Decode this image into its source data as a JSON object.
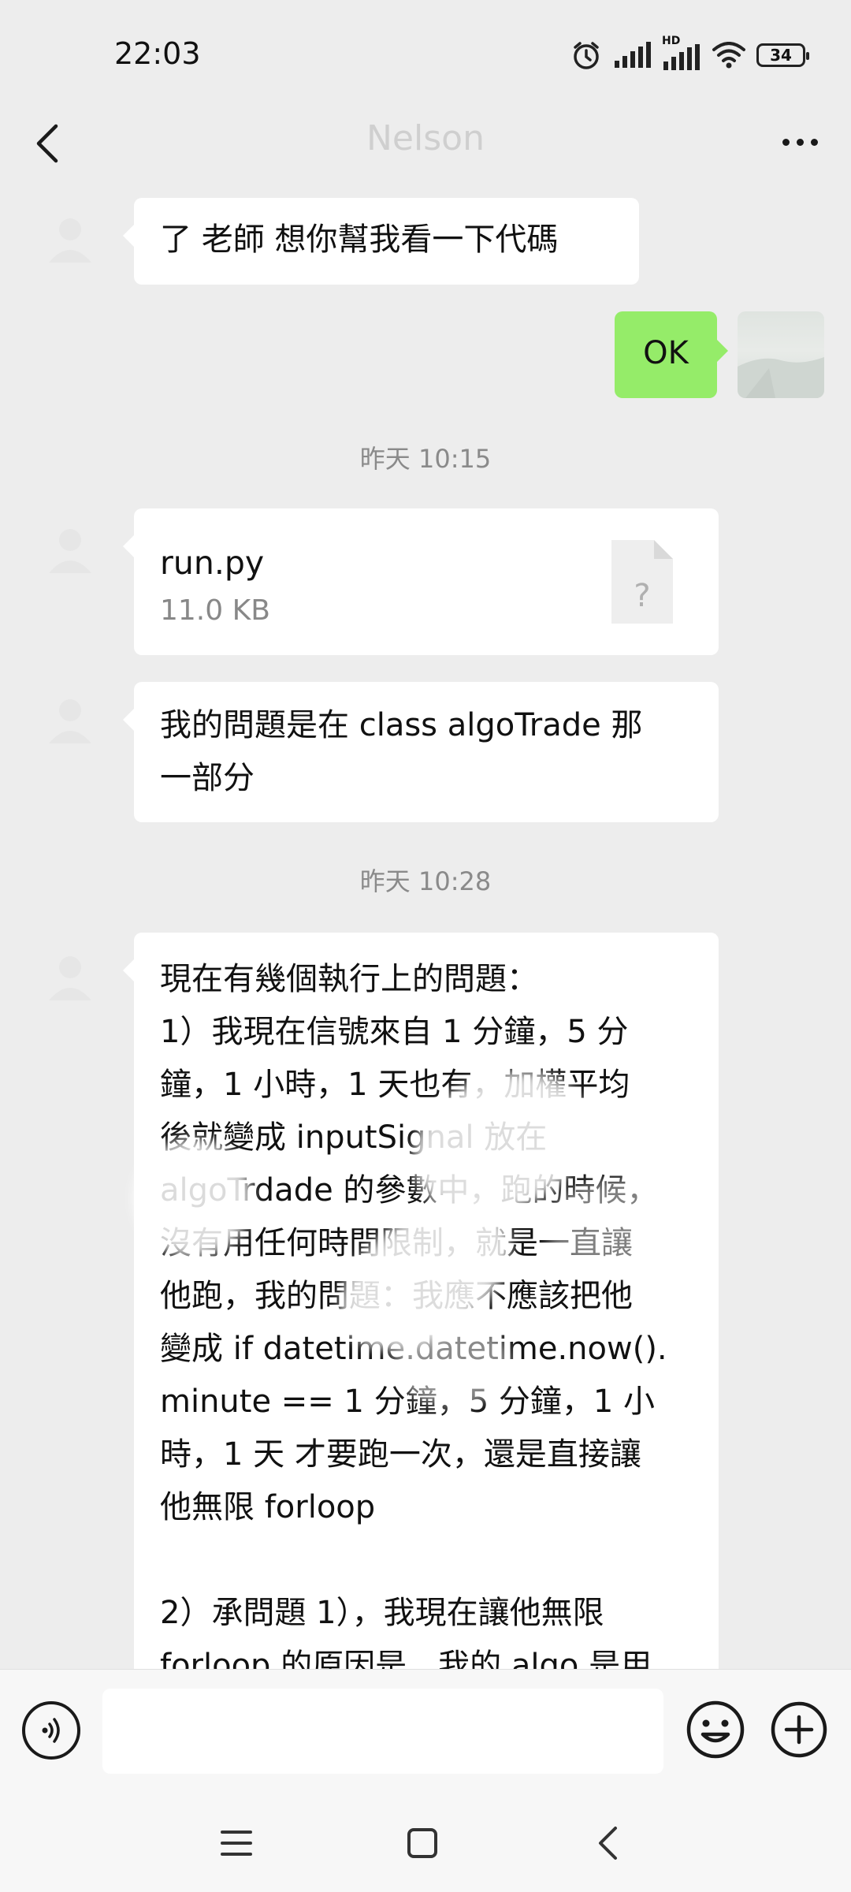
{
  "status_bar": {
    "time": "22:03",
    "network_label": "HD",
    "battery": "34",
    "icons": [
      "alarm-icon",
      "signal-icon",
      "hd-signal-icon",
      "wifi-icon",
      "battery-icon"
    ]
  },
  "header": {
    "title": "Nelson",
    "back_icon": "chevron-left-icon",
    "more_icon": "more-dots-icon"
  },
  "messages": [
    {
      "type": "text",
      "from": "contact",
      "text": "了 老師 想你幫我看一下代碼"
    },
    {
      "type": "text",
      "from": "me",
      "text": "OK"
    },
    {
      "type": "timestamp",
      "text": "昨天 10:15"
    },
    {
      "type": "file",
      "from": "contact",
      "filename": "run.py",
      "size": "11.0 KB",
      "icon": "unknown-file-icon",
      "icon_glyph": "?"
    },
    {
      "type": "text",
      "from": "contact",
      "lines": [
        "我的問題是在 class algoTrade 那",
        "一部分"
      ]
    },
    {
      "type": "timestamp",
      "text": "昨天 10:28"
    },
    {
      "type": "text",
      "from": "contact",
      "lines": [
        "現在有幾個執行上的問題：",
        "1）我現在信號來自 1 分鐘，5 分",
        "鐘，1 小時，1 天也有，加權平均",
        "後就變成 inputSignal 放在",
        "algoTrdade 的參數中，跑的時候，",
        "沒有用任何時間限制，就是一直讓",
        "他跑，我的問題：我應不應該把他",
        "變成 if datetime.datetime.now().",
        "minute == 1 分鐘，5 分鐘，1 小",
        "時，1 天 才要跑一次，還是直接讓",
        "他無限 forloop",
        "",
        "2）承問題 1），我現在讓他無限",
        "forloop 的原因是，我的 algo 是用"
      ]
    }
  ],
  "input_bar": {
    "placeholder": "",
    "voice_icon": "voice-icon",
    "emoji_icon": "emoji-icon",
    "plus_icon": "plus-icon"
  },
  "nav_bar": {
    "icons": [
      "menu-icon",
      "home-icon",
      "back-icon"
    ]
  },
  "colors": {
    "background": "#ededed",
    "bubble_incoming": "#ffffff",
    "bubble_outgoing": "#95ec69",
    "timestamp_text": "#8a8a8a"
  }
}
